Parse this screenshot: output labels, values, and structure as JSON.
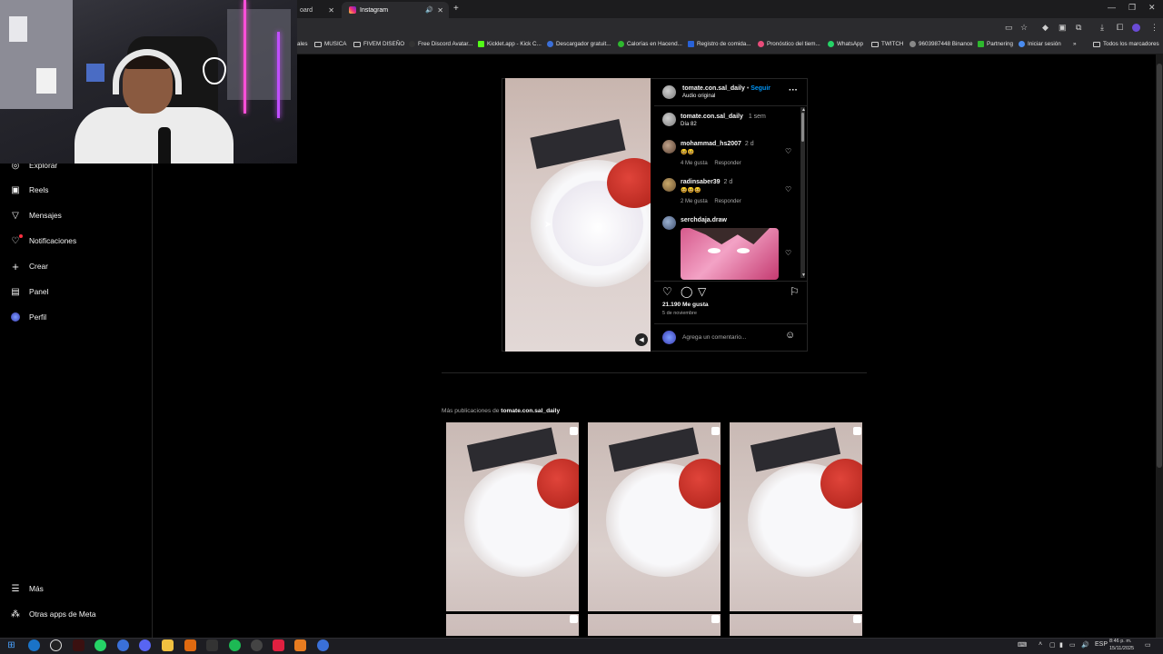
{
  "browser": {
    "tabs": [
      {
        "label": "oard"
      },
      {
        "label": "Instagram"
      }
    ],
    "new_tab_symbol": "+",
    "bookmarks": [
      {
        "label": "ales",
        "icon": "none"
      },
      {
        "label": "MUSICA",
        "icon": "folder-icon"
      },
      {
        "label": "FIVEM DISEÑO",
        "icon": "folder-icon"
      },
      {
        "label": "Free Discord Avatar...",
        "icon": "discord-icon"
      },
      {
        "label": "Kicklet.app - Kick C...",
        "icon": "kick-icon"
      },
      {
        "label": "Descargador gratuit...",
        "icon": "download-site-icon"
      },
      {
        "label": "Calorías en Hacend...",
        "icon": "green-site-icon"
      },
      {
        "label": "Registro de comida...",
        "icon": "blue-site-icon"
      },
      {
        "label": "Pronóstico del tiem...",
        "icon": "weather-icon"
      },
      {
        "label": "WhatsApp",
        "icon": "whatsapp-icon"
      },
      {
        "label": "TWITCH",
        "icon": "folder-icon"
      },
      {
        "label": "9603987448 Binance",
        "icon": "binance-icon"
      },
      {
        "label": "Partnering",
        "icon": "partner-icon"
      },
      {
        "label": "Iniciar sesión",
        "icon": "login-icon"
      },
      {
        "label": "»",
        "icon": "none"
      },
      {
        "label": "Todos los marcadores",
        "icon": "folder-icon"
      }
    ]
  },
  "sidebar": {
    "items": [
      {
        "label": "Explorar",
        "icon": "compass-icon"
      },
      {
        "label": "Reels",
        "icon": "reels-icon"
      },
      {
        "label": "Mensajes",
        "icon": "messages-icon"
      },
      {
        "label": "Notificaciones",
        "icon": "heart-icon"
      },
      {
        "label": "Crear",
        "icon": "plus-icon"
      },
      {
        "label": "Panel",
        "icon": "panel-icon"
      },
      {
        "label": "Perfil",
        "icon": "profile-avatar"
      }
    ],
    "more": "Más",
    "meta": "Otras apps de Meta"
  },
  "post": {
    "header": {
      "username": "tomate.con.sal_daily",
      "separator": "•",
      "follow": "Seguir",
      "audio": "Audio original"
    },
    "caption": {
      "username": "tomate.con.sal_daily",
      "time": "1 sem",
      "text": "Día 82"
    },
    "comments": [
      {
        "username": "mohammad_hs2007",
        "time": "2 d",
        "text": "😆😆",
        "likes": "4 Me gusta",
        "reply": "Responder"
      },
      {
        "username": "radinsaber39",
        "time": "2 d",
        "text": "😆😆😆",
        "likes": "2 Me gusta",
        "reply": "Responder"
      },
      {
        "username": "serchdaja.draw",
        "time": "",
        "text": "",
        "likes": "",
        "reply": ""
      }
    ],
    "likes_count": "21.190 Me gusta",
    "date": "5 de noviembre",
    "comment_placeholder": "Agrega un comentario..."
  },
  "more_posts": {
    "prefix": "Más publicaciones de",
    "username": "tomate.con.sal_daily",
    "count": 3
  },
  "taskbar": {
    "language": "ESP",
    "time": "8:46 p. m.",
    "date": "15/11/2025"
  }
}
